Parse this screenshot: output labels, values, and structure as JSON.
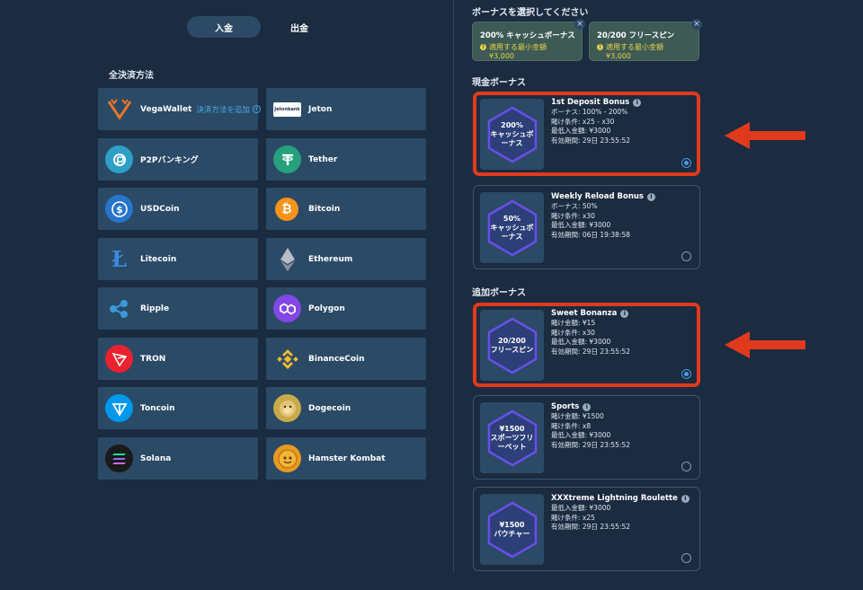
{
  "tabs": {
    "deposit": "入金",
    "withdraw": "出金"
  },
  "methods_title": "全決済方法",
  "methods": [
    {
      "name": "VegaWallet",
      "icon": "vegawallet-logo-icon",
      "add_label": "決済方法を追加"
    },
    {
      "name": "Jeton",
      "icon": "jetonbank-logo-icon",
      "logo_text": "Jetonbank"
    },
    {
      "name": "P2Pバンキング",
      "icon": "p2p-banking-icon"
    },
    {
      "name": "Tether",
      "icon": "tether-icon"
    },
    {
      "name": "USDCoin",
      "icon": "usdcoin-icon"
    },
    {
      "name": "Bitcoin",
      "icon": "bitcoin-icon"
    },
    {
      "name": "Litecoin",
      "icon": "litecoin-icon"
    },
    {
      "name": "Ethereum",
      "icon": "ethereum-icon"
    },
    {
      "name": "Ripple",
      "icon": "ripple-icon"
    },
    {
      "name": "Polygon",
      "icon": "polygon-icon"
    },
    {
      "name": "TRON",
      "icon": "tron-icon"
    },
    {
      "name": "BinanceCoin",
      "icon": "binancecoin-icon"
    },
    {
      "name": "Toncoin",
      "icon": "toncoin-icon"
    },
    {
      "name": "Dogecoin",
      "icon": "dogecoin-icon"
    },
    {
      "name": "Solana",
      "icon": "solana-icon"
    },
    {
      "name": "Hamster Kombat",
      "icon": "hamster-kombat-icon"
    }
  ],
  "bonus_select_title": "ボーナスを選択してください",
  "selected_chips": [
    {
      "title": "200% キャッシュボーナス",
      "min_label": "適用する最小金額",
      "min_value": "¥3,000"
    },
    {
      "title": "20/200 フリースピン",
      "min_label": "適用する最小金額",
      "min_value": "¥3,000"
    }
  ],
  "cash_bonus_title": "現金ボーナス",
  "extra_bonus_title": "追加ボーナス",
  "cards": [
    {
      "badge": "200%\nキャッシュボーナス",
      "name": "1st Deposit Bonus",
      "selected": true,
      "highlighted": true,
      "lines": [
        "ボーナス: 100% - 200%",
        "賭け条件: x25 - x30",
        "最低入金額: ¥3000",
        "有効期間: 29日 23:55:52"
      ]
    },
    {
      "badge": "50%\nキャッシュボーナス",
      "name": "Weekly Reload Bonus",
      "selected": false,
      "highlighted": false,
      "lines": [
        "ボーナス: 50%",
        "賭け条件: x30",
        "最低入金額: ¥3000",
        "有効期間: 06日 19:38:58"
      ]
    },
    {
      "badge": "20/200\nフリースピン",
      "name": "Sweet Bonanza",
      "selected": true,
      "highlighted": true,
      "lines": [
        "賭け金額: ¥15",
        "賭け条件: x30",
        "最低入金額: ¥3000",
        "有効期間: 29日 23:55:52"
      ]
    },
    {
      "badge": "¥1500\nスポーツフリーベット",
      "name": "Sports",
      "selected": false,
      "highlighted": false,
      "lines": [
        "賭け金額: ¥1500",
        "賭け条件: x8",
        "最低入金額: ¥3000",
        "有効期間: 29日 23:55:52"
      ]
    },
    {
      "badge": "¥1500\nバウチャー",
      "name": "XXXtreme Lightning Roulette",
      "selected": false,
      "highlighted": false,
      "lines": [
        "最低入金額: ¥3000",
        "賭け条件: x25",
        "有効期間: 29日 23:55:52"
      ]
    }
  ],
  "colors": {
    "background": "#1b2b40",
    "tile": "#2a4a66",
    "highlight": "#e0391c",
    "accent_blue": "#4a9be8",
    "chip_yellow": "#e8d24a"
  }
}
